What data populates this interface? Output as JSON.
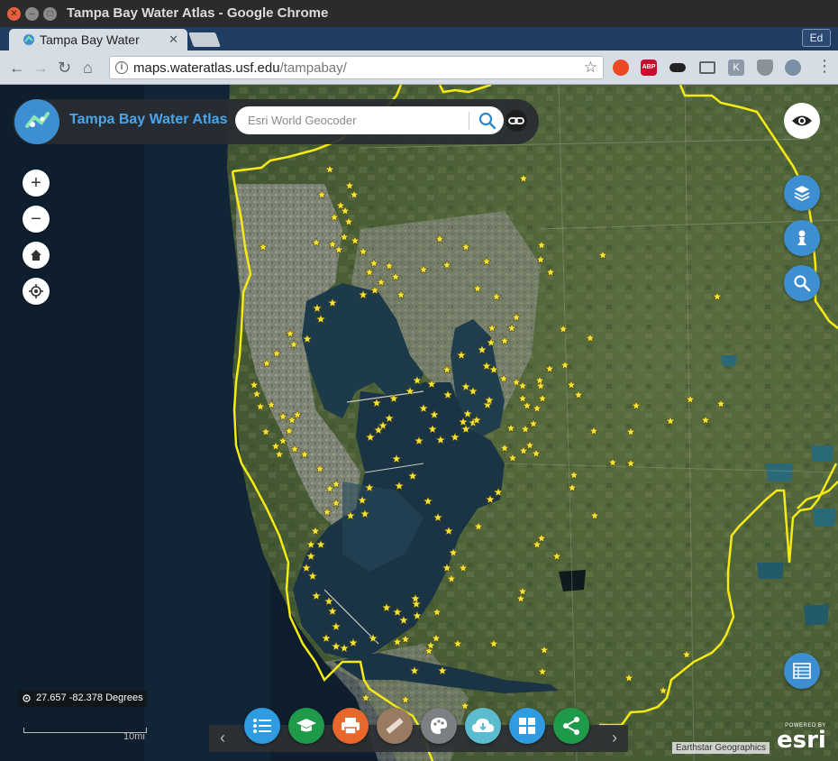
{
  "window": {
    "title": "Tampa Bay Water Atlas - Google Chrome"
  },
  "browser": {
    "tab_title": "Tampa Bay Water",
    "url_host": "maps.wateratlas.usf.edu",
    "url_path": "/tampabay/",
    "profile": "Ed",
    "extensions": [
      "stumbleupon-icon",
      "adblock-plus-icon",
      "mask-icon",
      "cast-icon",
      "k-extension-icon",
      "shield-icon",
      "person-extension-icon"
    ]
  },
  "app": {
    "title": "Tampa Bay Water Atlas",
    "search_placeholder": "Esri World Geocoder"
  },
  "map": {
    "coordinates": "27.657 -82.378 Degrees",
    "scale_label": "10mi",
    "attribution": "Earthstar Geographics",
    "esri_powered": "POWERED BY",
    "esri_brand": "esri",
    "boundary_color": "#f5ea14",
    "marker_color": "#f2e23a"
  },
  "tools": [
    {
      "name": "list-tool",
      "color": "#2f9be0"
    },
    {
      "name": "education-tool",
      "color": "#1f9a48"
    },
    {
      "name": "print-tool",
      "color": "#e8672a"
    },
    {
      "name": "measure-tool",
      "color": "#9a7b62"
    },
    {
      "name": "draw-tool",
      "color": "#7c7f84"
    },
    {
      "name": "download-tool",
      "color": "#5bbcd0"
    },
    {
      "name": "dashboard-tool",
      "color": "#2f9be0"
    },
    {
      "name": "share-tool",
      "color": "#1f9a48"
    }
  ]
}
